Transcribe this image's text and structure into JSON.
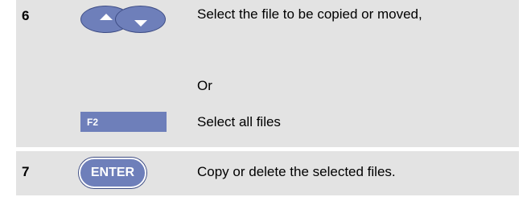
{
  "steps": [
    {
      "number": "6",
      "text": "Select the file to be copied or moved,",
      "or_label": "Or",
      "fkey_label": "F2",
      "fkey_text": "Select all files"
    },
    {
      "number": "7",
      "key_label": "ENTER",
      "text": "Copy or delete the selected files."
    }
  ],
  "colors": {
    "band": "#e3e3e3",
    "key": "#6e7fba"
  },
  "icons": [
    "arrow-up-key-icon",
    "arrow-down-key-icon"
  ]
}
